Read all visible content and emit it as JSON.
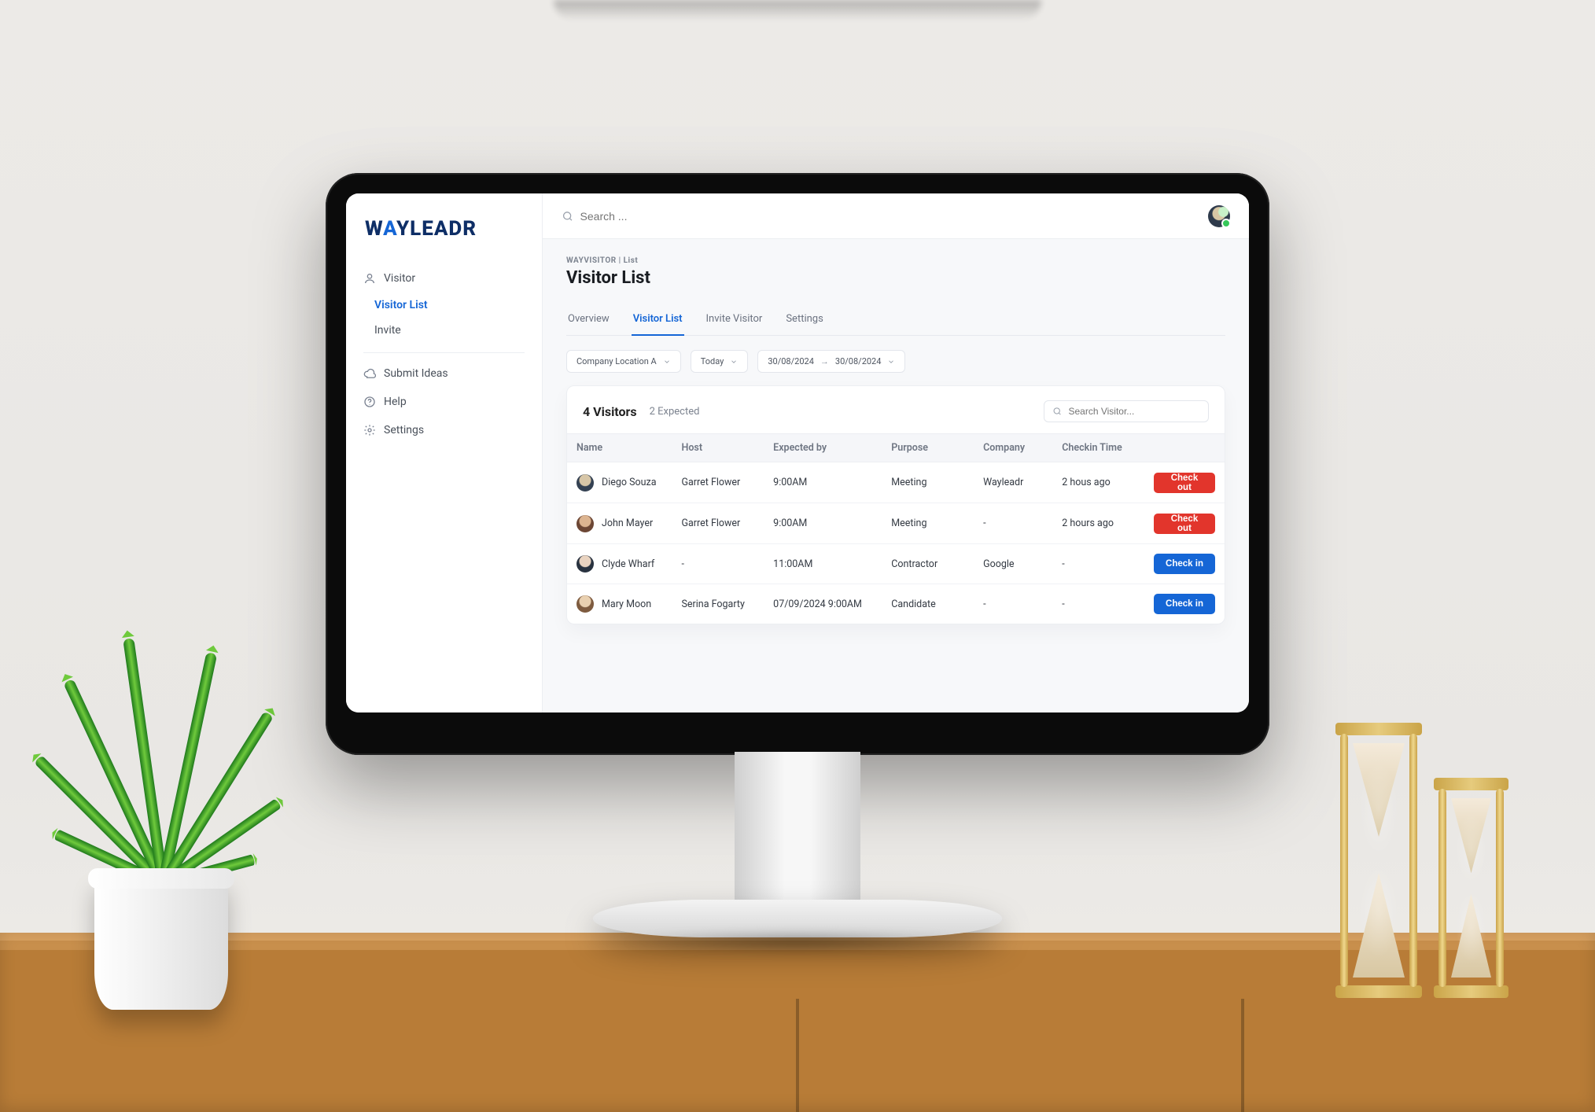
{
  "brand": {
    "a": "W",
    "b": "A",
    "c": "YLEADR"
  },
  "topbar": {
    "search_placeholder": "Search ..."
  },
  "sidebar": {
    "visitor_label": "Visitor",
    "visitor_list": "Visitor List",
    "visitor_invite": "Invite",
    "submit_ideas": "Submit Ideas",
    "help": "Help",
    "settings": "Settings"
  },
  "page": {
    "crumb": "WAYVISITOR | List",
    "title": "Visitor List"
  },
  "tabs": {
    "overview": "Overview",
    "visitor_list": "Visitor List",
    "invite_visitor": "Invite Visitor",
    "settings": "Settings"
  },
  "filters": {
    "location": "Company Location A",
    "range": "Today",
    "date_from": "30/08/2024",
    "date_to": "30/08/2024"
  },
  "summary": {
    "count_label": "4 Visitors",
    "expected_label": "2 Expected",
    "table_search_placeholder": "Search Visitor..."
  },
  "columns": {
    "name": "Name",
    "host": "Host",
    "expected": "Expected by",
    "purpose": "Purpose",
    "company": "Company",
    "checkin": "Checkin Time"
  },
  "buttons": {
    "check_out": "Check out",
    "check_in": "Check in"
  },
  "rows": [
    {
      "name": "Diego Souza",
      "host": "Garret Flower",
      "expected": "9:00AM",
      "purpose": "Meeting",
      "company": "Wayleadr",
      "checkin": "2 hous ago",
      "action": "out"
    },
    {
      "name": "John Mayer",
      "host": "Garret Flower",
      "expected": "9:00AM",
      "purpose": "Meeting",
      "company": "-",
      "checkin": "2 hours ago",
      "action": "out"
    },
    {
      "name": "Clyde Wharf",
      "host": "-",
      "expected": "11:00AM",
      "purpose": "Contractor",
      "company": "Google",
      "checkin": "-",
      "action": "in"
    },
    {
      "name": "Mary Moon",
      "host": "Serina Fogarty",
      "expected": "07/09/2024 9:00AM",
      "purpose": "Candidate",
      "company": "-",
      "checkin": "-",
      "action": "in"
    }
  ]
}
